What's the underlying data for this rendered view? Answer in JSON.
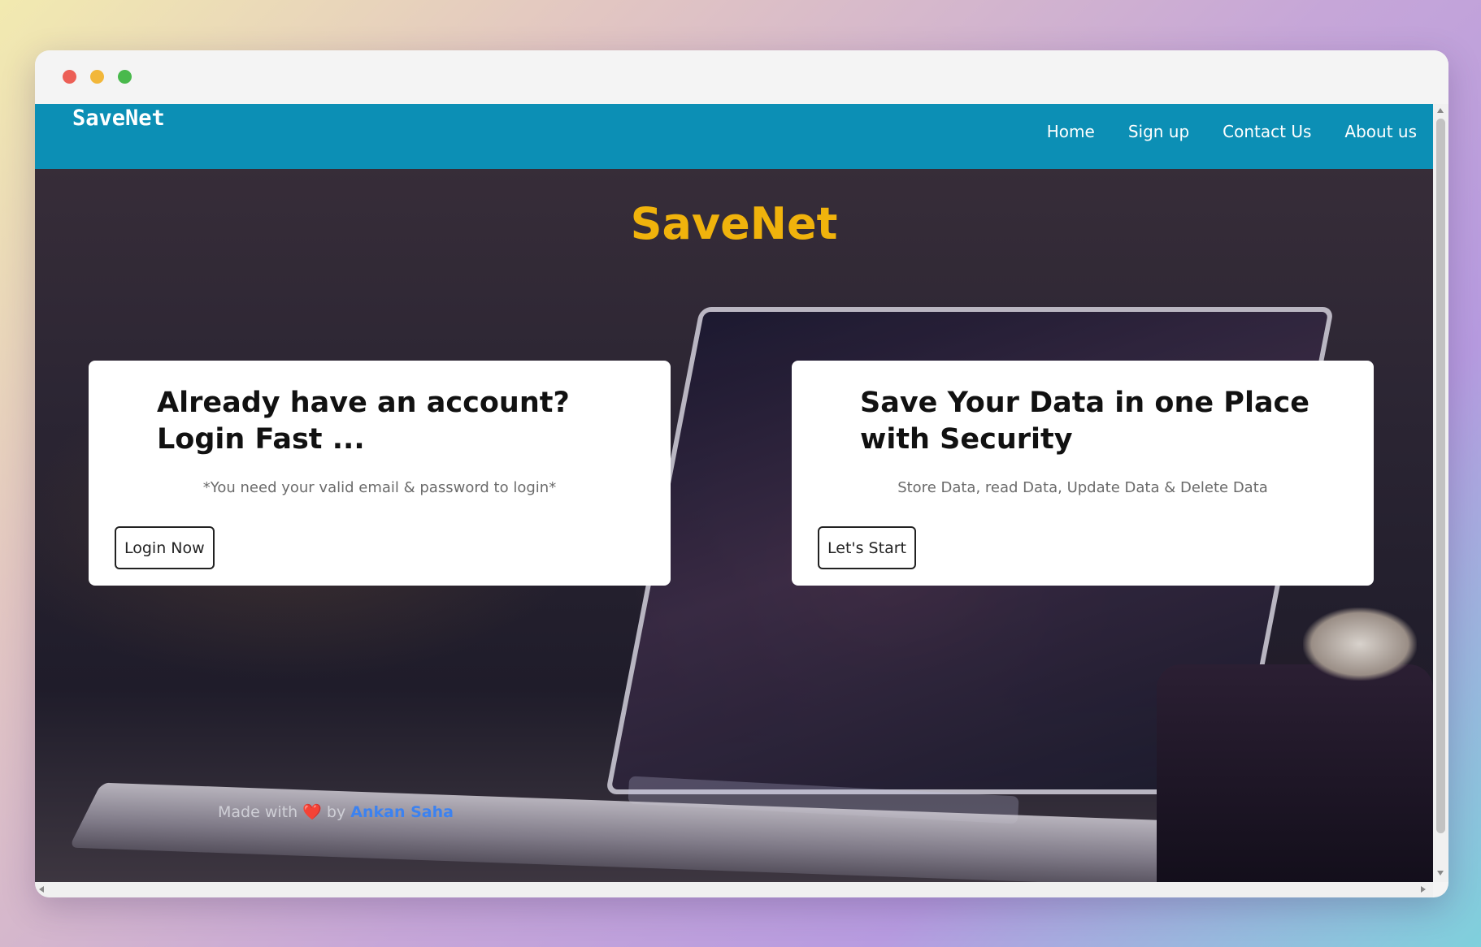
{
  "window": {
    "controls": [
      "close",
      "minimize",
      "maximize"
    ]
  },
  "navbar": {
    "brand": "SaveNet",
    "links": [
      "Home",
      "Sign up",
      "Contact Us",
      "About us"
    ],
    "background_color": "#0c8fb5"
  },
  "hero": {
    "title": "SaveNet",
    "title_color": "#f0b30c"
  },
  "cards": {
    "login": {
      "heading_line1": "Already have an account?",
      "heading_line2": "Login Fast ...",
      "note": "*You need your valid email & password to login*",
      "button": "Login Now"
    },
    "start": {
      "heading_line1": "Save Your Data in one Place",
      "heading_line2": "with Security",
      "note": "Store Data, read Data, Update Data & Delete Data",
      "button": "Let's Start"
    }
  },
  "footer": {
    "prefix": "Made with",
    "heart": "❤️",
    "by": "by",
    "author": "Ankan Saha"
  }
}
